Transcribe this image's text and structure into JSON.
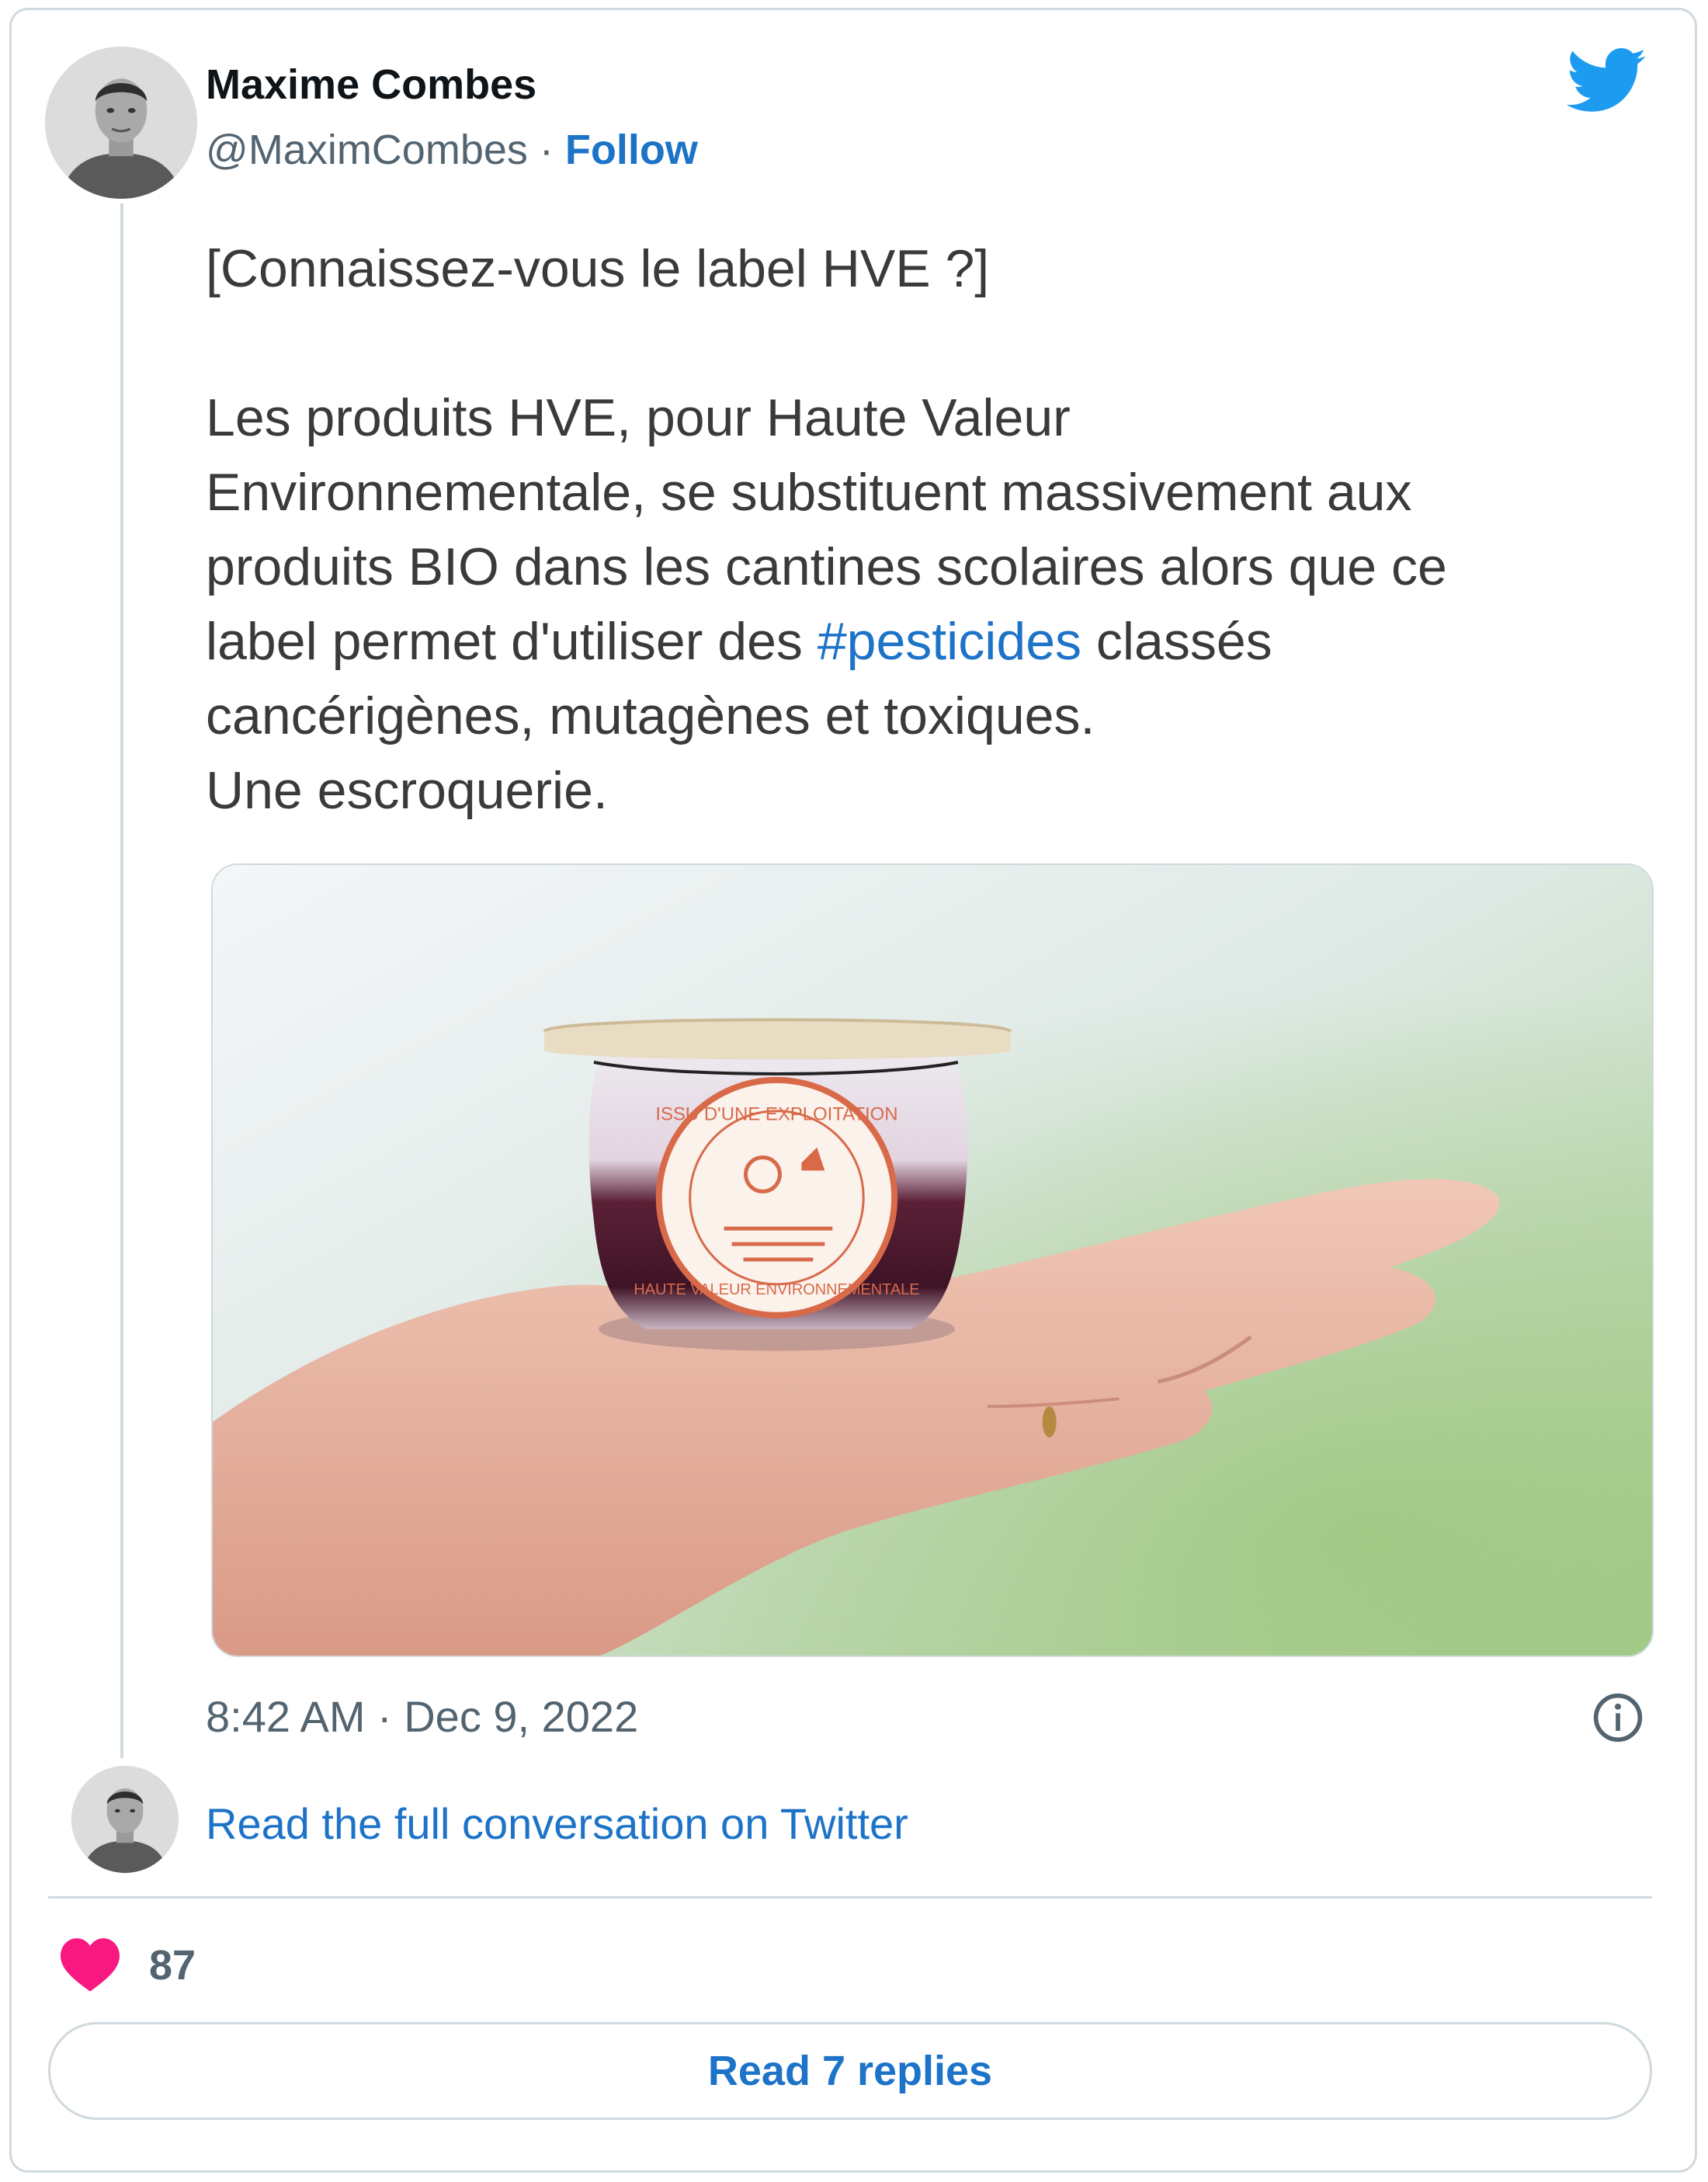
{
  "author": {
    "name": "Maxime Combes",
    "handle": "@MaximCombes",
    "separator": " · ",
    "follow_label": "Follow"
  },
  "tweet": {
    "lines_intro": [
      "[Connaissez-vous le label HVE ?]"
    ],
    "line1": "Les produits HVE, pour Haute Valeur",
    "line2": "Environnementale,  se substituent massivement aux",
    "line3": "produits BIO dans les cantines scolaires alors que ce",
    "line4_before": "label permet d'utiliser des ",
    "hashtag": "#pesticides",
    "line4_after": " classés",
    "line5": "cancérigènes, mutagènes et toxiques.",
    "line6": "Une escroquerie."
  },
  "media": {
    "label_top": "ISSU D'UNE EXPLOITATION",
    "label_bottom": "HAUTE VALEUR ENVIRONNEMENTALE"
  },
  "timestamp": "8:42 AM · Dec 9, 2022",
  "read_conversation_label": "Read the full conversation on Twitter",
  "likes": "87",
  "replies_button_label": "Read 7 replies",
  "colors": {
    "link": "#1d73c8",
    "heart": "#f91880",
    "twitter_blue": "#1d9bf0",
    "border": "#cfd9de",
    "secondary_text": "#536471"
  },
  "icons": {
    "brand": "twitter-bird-icon",
    "info": "info-icon",
    "like": "heart-icon"
  }
}
